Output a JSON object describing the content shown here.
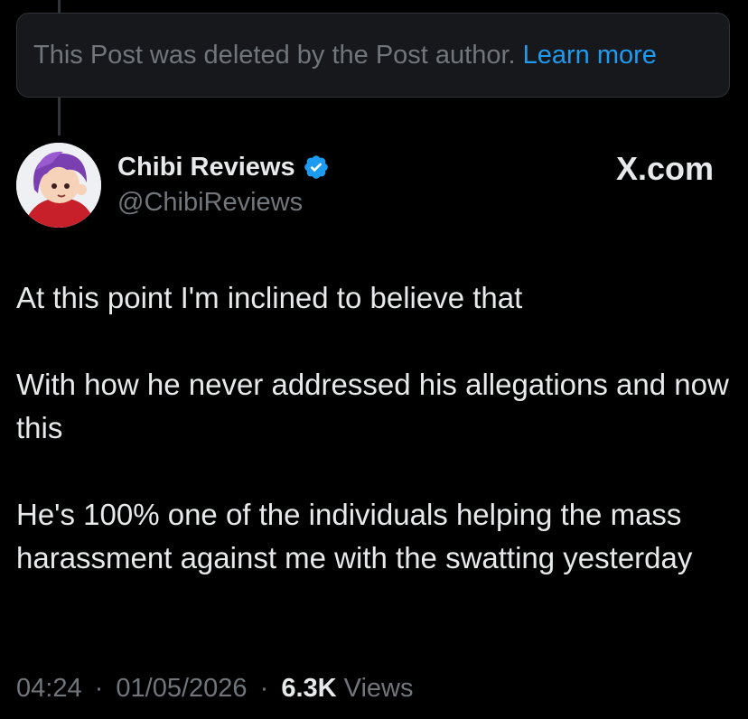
{
  "deleted_notice": {
    "text": "This Post was deleted by the Post author.",
    "link": "Learn more"
  },
  "author": {
    "name": "Chibi Reviews",
    "handle": "@ChibiReviews",
    "verified_icon": "verified-badge-icon",
    "avatar_icon": "avatar-illustration"
  },
  "brand": {
    "label": "X.com"
  },
  "post": {
    "paragraphs": [
      "At this point I'm inclined to believe that",
      "With how he never addressed his allegations and now this",
      "He's 100% one of the individuals helping the mass harassment against me with the swatting yesterday"
    ]
  },
  "meta": {
    "time": "04:24",
    "separator": "·",
    "date": "01/05/2026",
    "views_count": "6.3K",
    "views_label": "Views"
  },
  "colors": {
    "background": "#000000",
    "text": "#e7e9ea",
    "muted": "#71767b",
    "link": "#1d9bf0"
  }
}
